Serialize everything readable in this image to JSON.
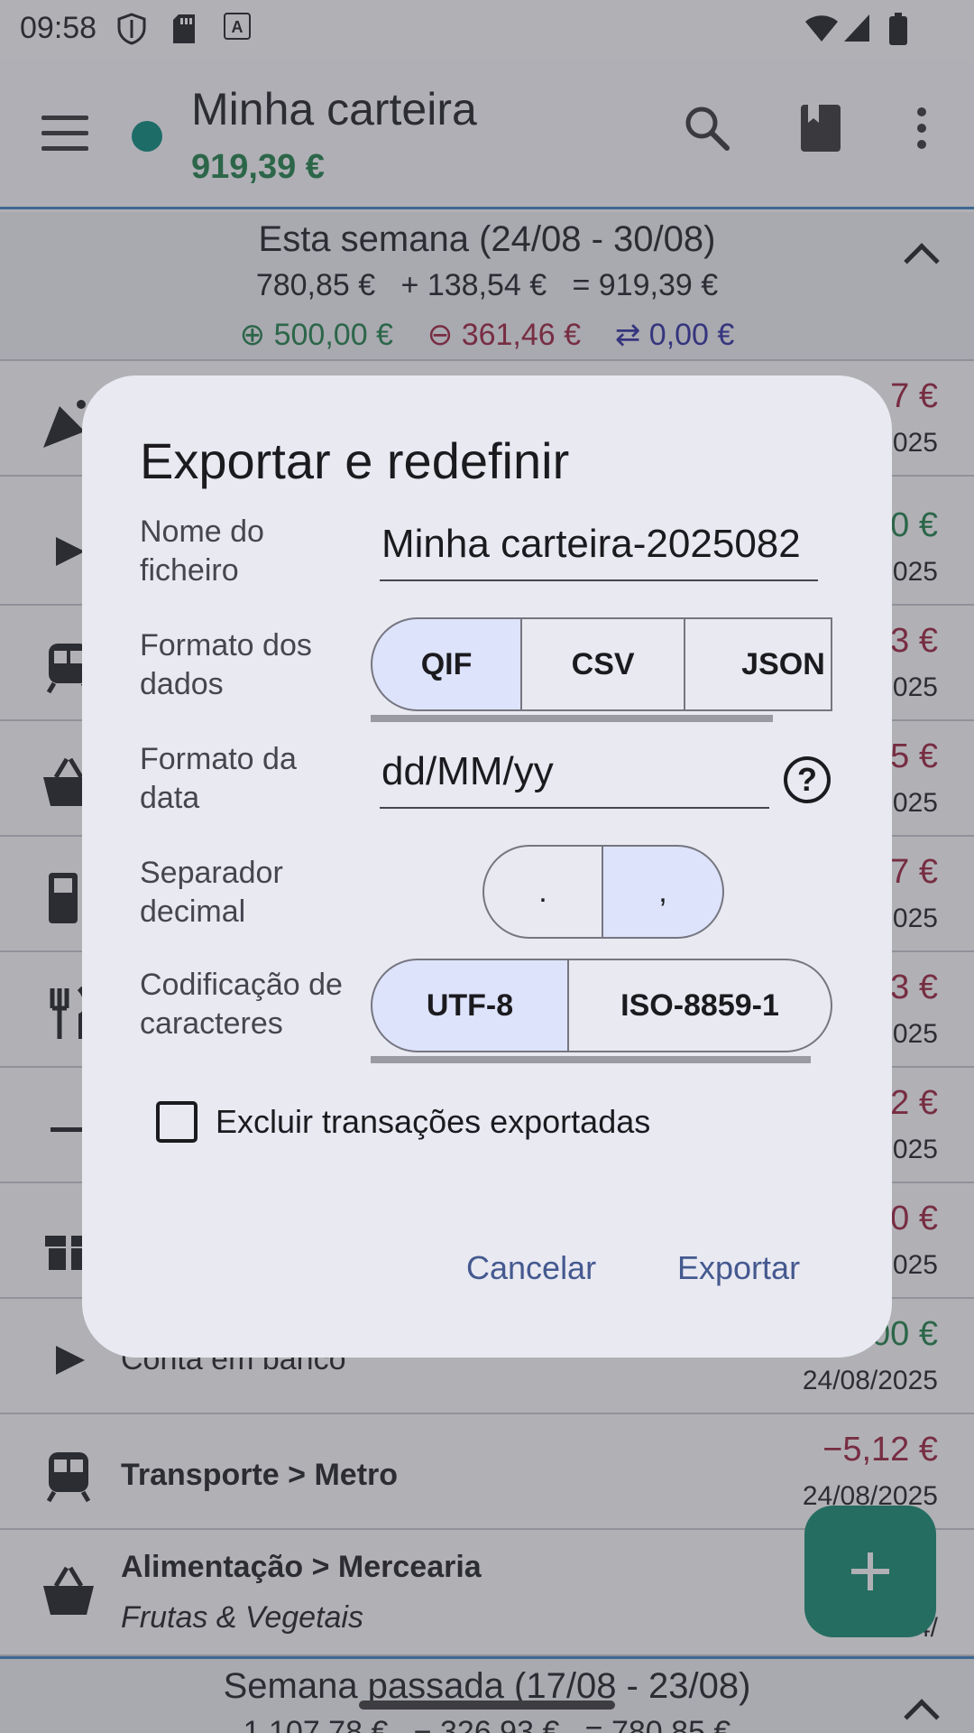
{
  "status_bar": {
    "time": "09:58",
    "icons": [
      "shield-icon",
      "sd-card-icon",
      "font-a-icon"
    ],
    "right_icons": [
      "wifi-icon",
      "signal-icon",
      "battery-icon"
    ]
  },
  "app_bar": {
    "title": "Minha carteira",
    "balance": "919,39 €",
    "actions": [
      "search-icon",
      "book-icon",
      "more-vert-icon"
    ]
  },
  "week_summary": {
    "title": "Esta semana (24/08 - 30/08)",
    "line": "780,85 €   + 138,54 €   = 919,39 €",
    "income": "⊕ 500,00 €",
    "expense": "⊖ 361,46 €",
    "transfer": "⇄ 0,00 €"
  },
  "rows": [
    {
      "icon": "party-icon",
      "title": "",
      "sub": "",
      "amount": "7 €",
      "date": "2025"
    },
    {
      "icon": "play-icon",
      "title": "",
      "sub": "",
      "amount": "0 €",
      "date": "2025"
    },
    {
      "icon": "train-icon",
      "title": "",
      "sub": "",
      "amount": "3 €",
      "date": "2025"
    },
    {
      "icon": "basket-icon",
      "title": "",
      "sub": "",
      "amount": "5 €",
      "date": "2025"
    },
    {
      "icon": "fuel-icon",
      "title": "",
      "sub": "",
      "amount": "7 €",
      "date": "2025"
    },
    {
      "icon": "fork-icon",
      "title": "",
      "sub": "",
      "amount": "3 €",
      "date": "2025"
    },
    {
      "icon": "minus-icon",
      "title": "",
      "sub": "",
      "amount": "2 €",
      "date": "2025"
    },
    {
      "icon": "gift-icon",
      "title": "",
      "sub": "",
      "amount": "0 €",
      "date": "2025"
    }
  ],
  "row_bank": {
    "label": "Conta em banco",
    "amount": ",00 €",
    "date": "24/08/2025"
  },
  "row_metro": {
    "title": "Transporte > Metro",
    "amount": "−5,12 €",
    "date": "24/08/2025"
  },
  "row_grocery": {
    "title": "Alimentação > Mercearia",
    "sub": "Frutas & Vegetais",
    "date": "24/"
  },
  "week2": {
    "title": "Semana passada (17/08 - 23/08)",
    "line": "1 107,78 €   − 326,93 €   = 780,85 €"
  },
  "dialog": {
    "title": "Exportar e redefinir",
    "filename_label": "Nome do ficheiro",
    "filename_value": "Minha carteira-2025082",
    "format_label": "Formato dos dados",
    "formats": [
      "QIF",
      "CSV",
      "JSON"
    ],
    "format_selected": "QIF",
    "date_label": "Formato da data",
    "date_value": "dd/MM/yy",
    "decimal_label": "Separador decimal",
    "decimals": [
      ".",
      ","
    ],
    "decimal_selected": ",",
    "encoding_label": "Codificação de caracteres",
    "encodings": [
      "UTF-8",
      "ISO-8859-1"
    ],
    "encoding_selected": "UTF-8",
    "delete_label": "Excluir transações exportadas",
    "delete_checked": false,
    "cancel": "Cancelar",
    "export": "Exportar"
  },
  "colors": {
    "accent": "#00897b",
    "income": "#1a7f45",
    "expense": "#9b1c3a",
    "transfer": "#2a2aa0",
    "dialog_button": "#44598f",
    "segment_selected": "#dde3fb"
  }
}
